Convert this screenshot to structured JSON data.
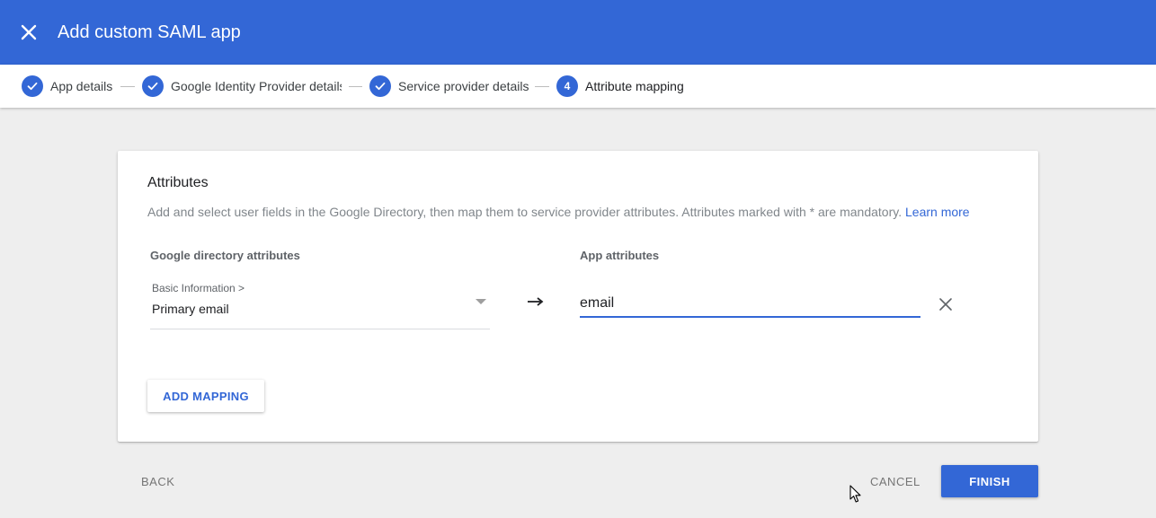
{
  "header": {
    "title": "Add custom SAML app",
    "close_icon": "close-icon",
    "background_color": "#3367d6"
  },
  "stepper": {
    "steps": [
      {
        "label": "App details",
        "status": "complete"
      },
      {
        "label": "Google Identity Provider details",
        "status": "complete"
      },
      {
        "label": "Service provider details",
        "status": "complete"
      },
      {
        "label": "Attribute mapping",
        "number": "4",
        "status": "active"
      }
    ]
  },
  "card": {
    "title": "Attributes",
    "description": "Add and select user fields in the Google Directory, then map them to service provider attributes. Attributes marked with * are mandatory.",
    "learn_more": "Learn more",
    "google_header": "Google directory attributes",
    "app_header": "App attributes",
    "mapping": {
      "category": "Basic Information >",
      "google_attribute": "Primary email",
      "app_attribute": "email"
    },
    "add_mapping_label": "ADD MAPPING"
  },
  "footer": {
    "back_label": "BACK",
    "cancel_label": "CANCEL",
    "finish_label": "FINISH"
  },
  "colors": {
    "accent": "#3367d6",
    "page_background": "#eeeeee"
  }
}
